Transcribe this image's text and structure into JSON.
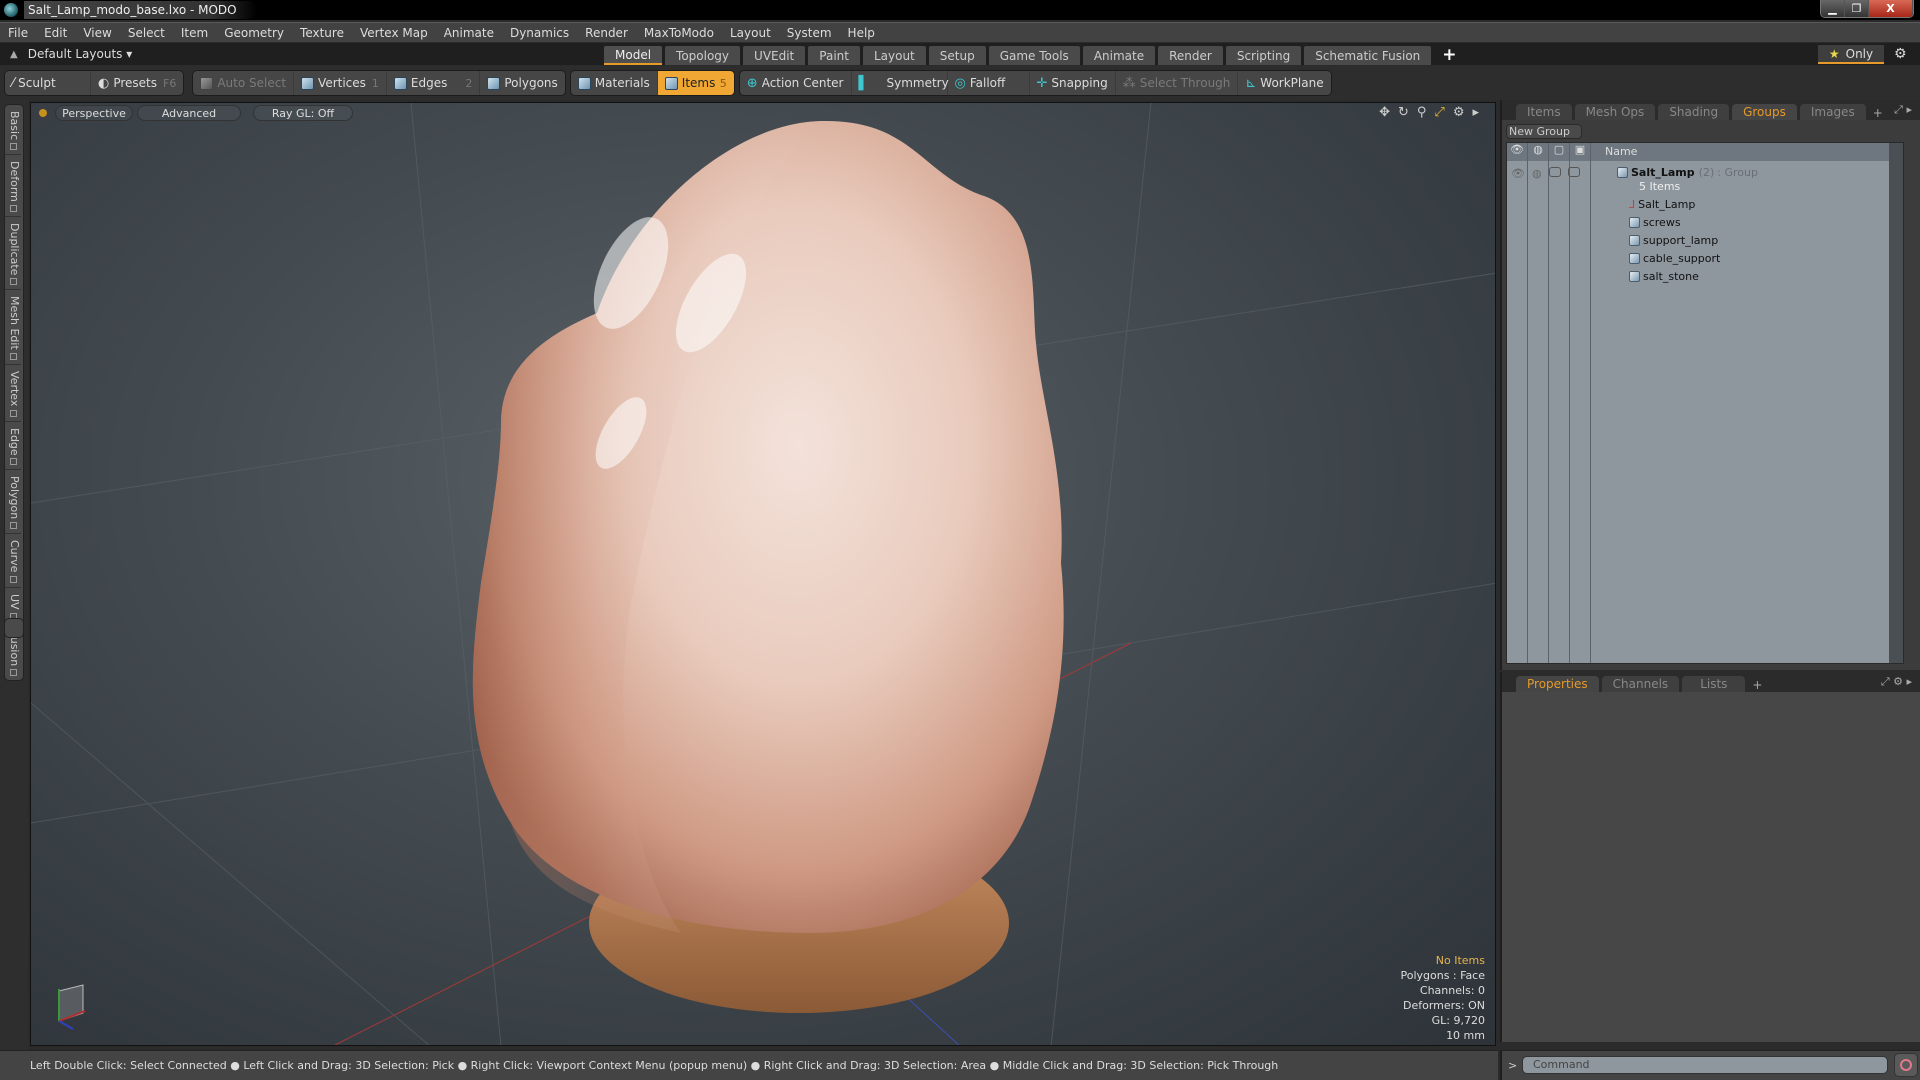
{
  "window": {
    "title": "Salt_Lamp_modo_base.lxo - MODO"
  },
  "menu": [
    "File",
    "Edit",
    "View",
    "Select",
    "Item",
    "Geometry",
    "Texture",
    "Vertex Map",
    "Animate",
    "Dynamics",
    "Render",
    "MaxToModo",
    "Layout",
    "System",
    "Help"
  ],
  "layoutbar": {
    "layouts_label": "Default Layouts ▾",
    "tabs": [
      "Model",
      "Topology",
      "UVEdit",
      "Paint",
      "Layout",
      "Setup",
      "Game Tools",
      "Animate",
      "Render",
      "Scripting",
      "Schematic Fusion"
    ],
    "active_tab": "Model",
    "only_label": "Only"
  },
  "toolbar": {
    "sculpt": "Sculpt",
    "presets": "Presets",
    "presets_key": "F6",
    "auto_select": "Auto Select",
    "vertices": "Vertices",
    "vertices_key": "1",
    "edges": "Edges",
    "edges_key": "2",
    "polygons": "Polygons",
    "materials": "Materials",
    "items": "Items",
    "items_key": "5",
    "action_center": "Action Center",
    "symmetry": "Symmetry",
    "falloff": "Falloff",
    "snapping": "Snapping",
    "select_through": "Select Through",
    "workplane": "WorkPlane"
  },
  "left_tabs": [
    "Basic",
    "Deform",
    "Duplicate",
    "Mesh Edit",
    "Vertex",
    "Edge",
    "Polygon",
    "Curve",
    "UV",
    "Fusion"
  ],
  "viewport": {
    "view_mode": "Perspective",
    "shading": "Advanced",
    "raygl": "Ray GL: Off",
    "hud": {
      "selection": "No Items",
      "polygons": "Polygons : Face",
      "channels": "Channels: 0",
      "deformers": "Deformers: ON",
      "gl": "GL: 9,720",
      "unit": "10 mm"
    }
  },
  "right_panel": {
    "tabs": [
      "Items",
      "Mesh Ops",
      "Shading",
      "Groups",
      "Images"
    ],
    "active_tab": "Groups",
    "new_group": "New Group",
    "name_header": "Name",
    "group": {
      "name": "Salt_Lamp",
      "count": "(2)",
      "type": ": Group",
      "items_label": "5 Items"
    },
    "items": [
      "Salt_Lamp",
      "screws",
      "support_lamp",
      "cable_support",
      "salt_stone"
    ]
  },
  "props_panel": {
    "tabs": [
      "Properties",
      "Channels",
      "Lists"
    ],
    "active_tab": "Properties"
  },
  "statusbar": {
    "hint": "Left Double Click: Select Connected ● Left Click and Drag: 3D Selection: Pick ● Right Click: Viewport Context Menu (popup menu) ● Right Click and Drag: 3D Selection: Area ● Middle Click and Drag: 3D Selection: Pick Through"
  },
  "command": {
    "placeholder": "Command"
  }
}
